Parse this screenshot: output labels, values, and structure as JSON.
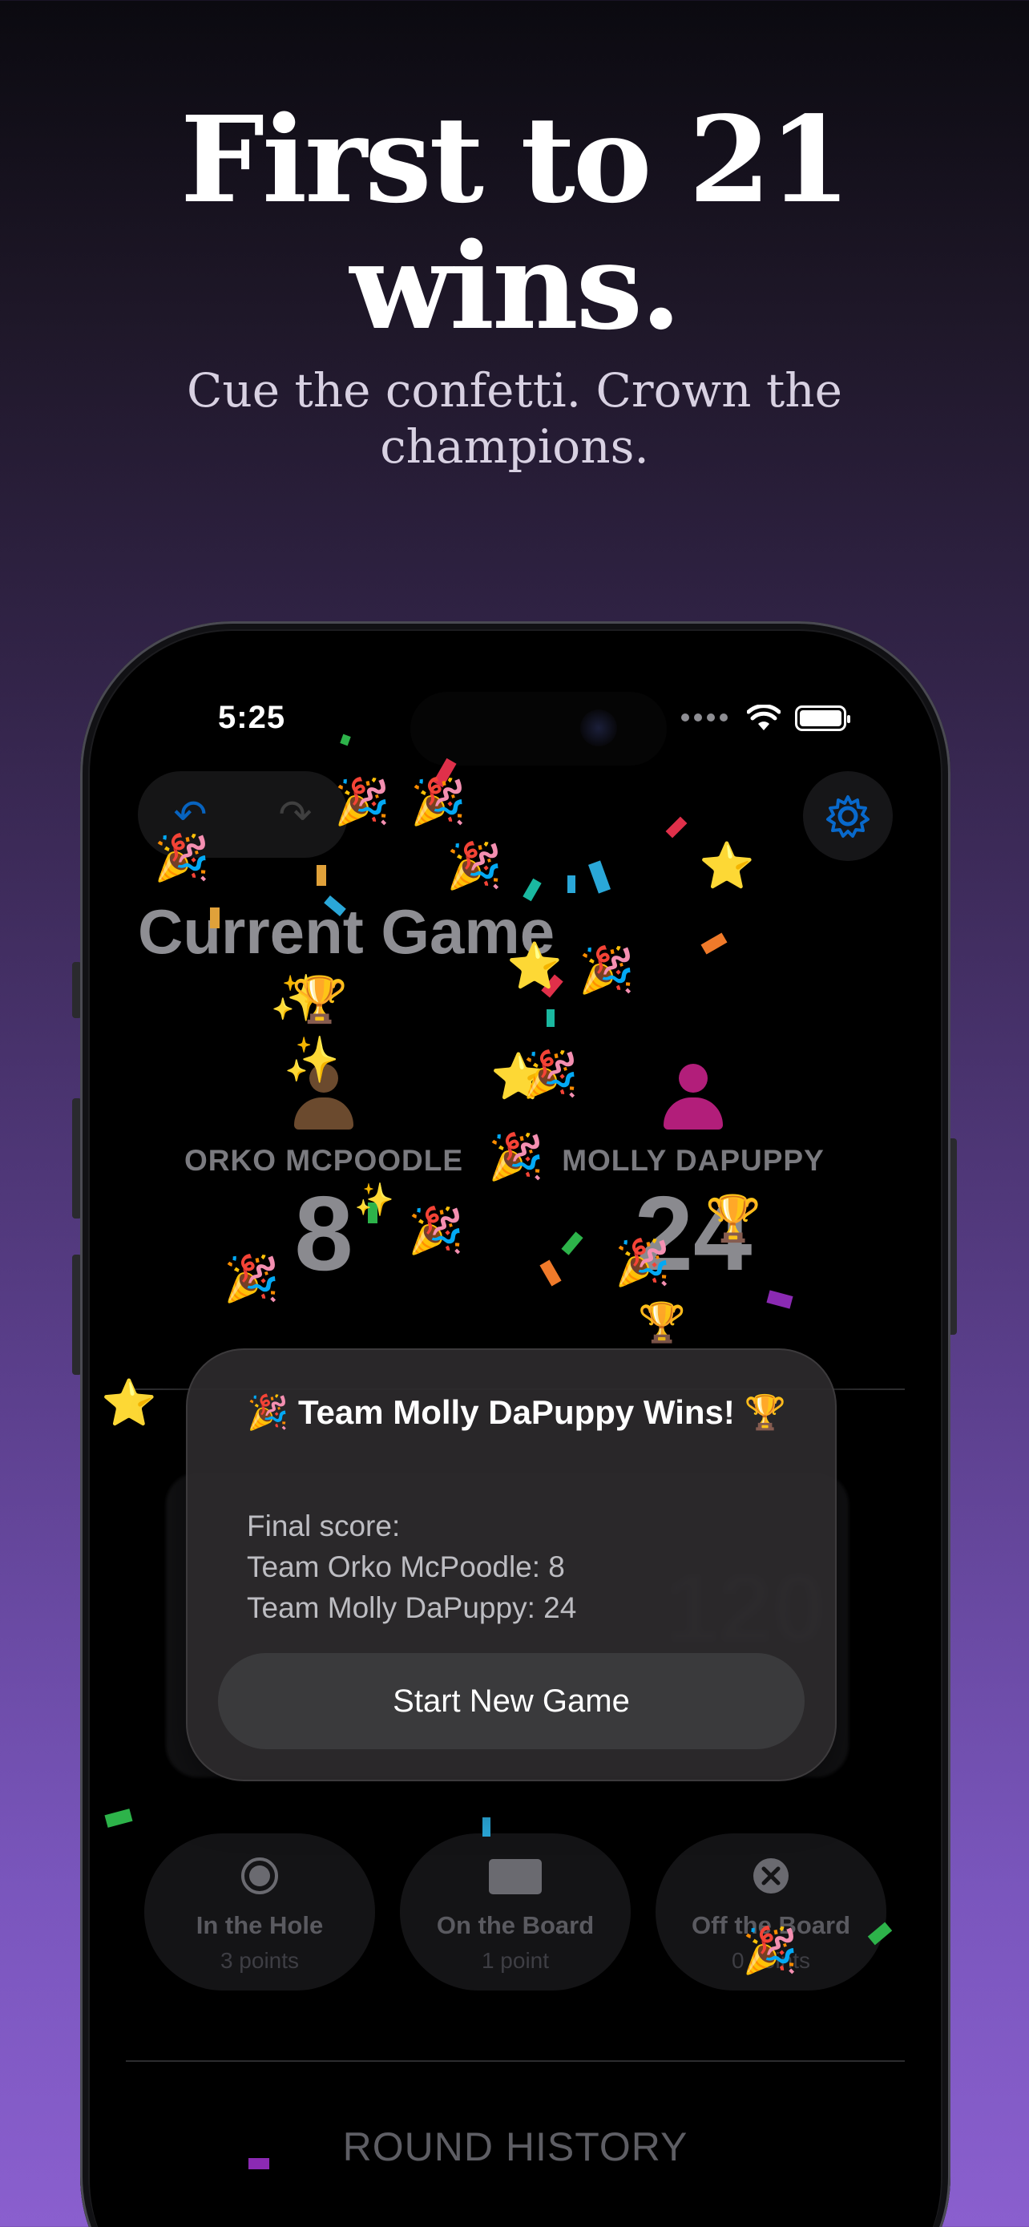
{
  "hero": {
    "title_line1": "First to 21",
    "title_line2": "wins.",
    "subtitle": "Cue the confetti. Crown the champions."
  },
  "status_bar": {
    "time": "5:25"
  },
  "app": {
    "page_title": "Current Game",
    "players": [
      {
        "name": "ORKO MCPOODLE",
        "score": "8",
        "color": "#6b4a2e"
      },
      {
        "name": "MOLLY DAPUPPY",
        "score": "24",
        "color": "#b21e7a"
      }
    ],
    "options": [
      {
        "label": "In the Hole",
        "points": "3 points"
      },
      {
        "label": "On the Board",
        "points": "1 point"
      },
      {
        "label": "Off the Board",
        "points": "0 points"
      }
    ],
    "round_history_label": "ROUND HISTORY"
  },
  "modal": {
    "title": "🎉 Team Molly DaPuppy Wins! 🏆",
    "final_score_label": "Final score:",
    "line1": "Team Orko McPoodle: 8",
    "line2": "Team Molly DaPuppy: 24",
    "button_label": "Start New Game"
  },
  "colors": {
    "accent": "#0a84ff",
    "background_top": "#0b0a10",
    "background_bottom": "#8a5fce"
  }
}
